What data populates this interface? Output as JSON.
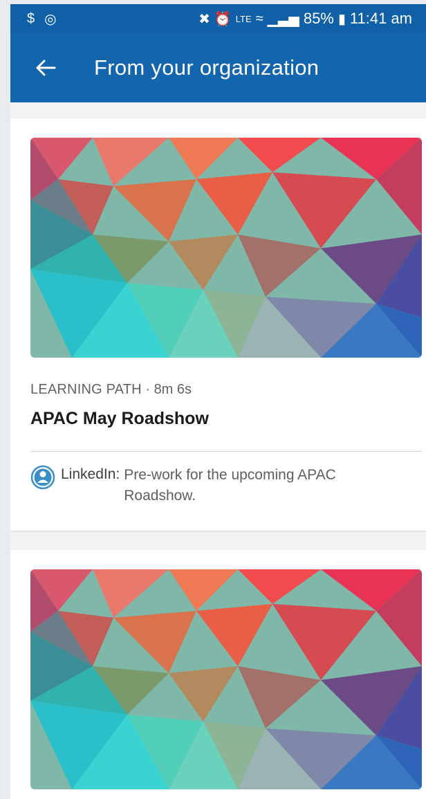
{
  "status_bar": {
    "icons_left": [
      "usb-debug-icon",
      "sync-icon"
    ],
    "icons_right": [
      "mute-icon",
      "alarm-icon",
      "volte-icon",
      "wifi-icon",
      "signal-icon"
    ],
    "battery": "85%",
    "time": "11:41 am"
  },
  "app_bar": {
    "title": "From your organization",
    "back_icon": "arrow-left-icon"
  },
  "cards": [
    {
      "type": "LEARNING PATH",
      "separator": " · ",
      "duration": "8m 6s",
      "title": "APAC May Roadshow",
      "recommender": "LinkedIn:",
      "message": "Pre-work for the upcoming APAC Roadshow."
    },
    {
      "type": "",
      "duration": "",
      "title": ""
    }
  ],
  "colors": {
    "app_bar": "#1365ad",
    "status_bar": "#1060a8",
    "avatar_icon": "#3a8fc7"
  }
}
